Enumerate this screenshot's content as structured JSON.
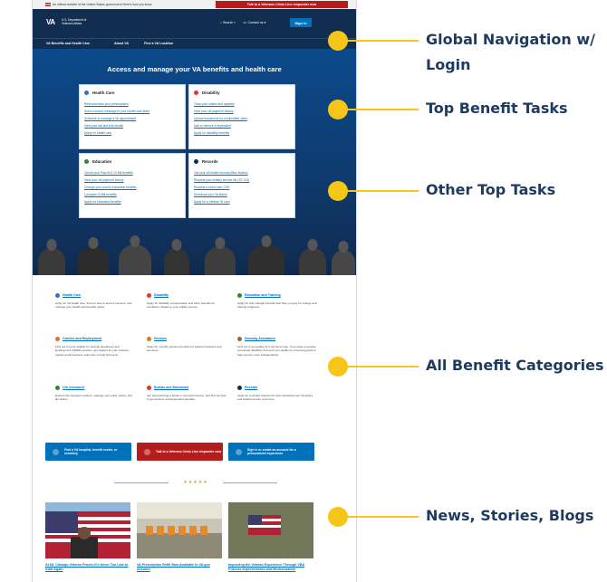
{
  "govbar": {
    "text": "An official website of the United States government  Here's how you know",
    "crisis_label": "Talk to a Veterans Crisis Line responder now"
  },
  "header": {
    "logo": "VA",
    "org_name": "U.S. Department of Veterans Affairs",
    "search_label": "Search",
    "contact_label": "Contact us",
    "signin_label": "Sign in"
  },
  "nav": {
    "items": [
      "VA Benefits and Health Care",
      "About VA",
      "Find a VA Location"
    ]
  },
  "hero": {
    "title": "Access and manage your VA benefits and health care",
    "cards": [
      {
        "title": "Health Care",
        "icon": "health-care-icon",
        "color": "#2378c3",
        "links": [
          "Refill and track your prescriptions",
          "Send a secure message to your health care team",
          "Schedule or manage a VA appointment",
          "View your lab and test results",
          "Apply for health care"
        ]
      },
      {
        "title": "Disability",
        "icon": "disability-icon",
        "color": "#d83933",
        "links": [
          "Track your claims and appeals",
          "View your VA payment history",
          "Upload documents for a submitted claim",
          "Add or remove a dependent",
          "Apply for disability benefits"
        ]
      },
      {
        "title": "Education",
        "icon": "education-icon",
        "color": "#2e8540",
        "links": [
          "Check your Post-9/11 GI Bill benefits",
          "View your VA payment history",
          "Change your current education benefits",
          "Compare GI Bill benefits",
          "Apply for education benefits"
        ]
      },
      {
        "title": "Records",
        "icon": "records-icon",
        "color": "#112e51",
        "links": [
          "Get your VA health records (Blue Button)",
          "Request your military service file (SF-214)",
          "Request a home loan COE",
          "Download your VA letters",
          "Apply for a Veteran ID card"
        ]
      }
    ]
  },
  "benefits": [
    {
      "title": "Health Care",
      "color": "#2378c3",
      "desc": "Apply for VA health care, find out how to access services, and manage your health and benefits online."
    },
    {
      "title": "Disability",
      "color": "#d83933",
      "desc": "Apply for disability compensation and other benefits for conditions related to your military service."
    },
    {
      "title": "Education and Training",
      "color": "#2e8540",
      "desc": "Apply for and manage benefits that help you pay for college and training programs."
    },
    {
      "title": "Careers and Employment",
      "color": "#e5751f",
      "desc": "Find out if you're eligible for Veteran Readiness and Employment (VR&E) services, get support for your Veteran-owned small business, and more to help find a job."
    },
    {
      "title": "Pension",
      "color": "#e5751f",
      "desc": "Apply for monthly pension benefits for wartime Veterans and survivors."
    },
    {
      "title": "Housing Assistance",
      "color": "#8b6e3f",
      "desc": "Find out if you qualify for a VA home loan. If you have a service-connected disability, find out if you qualify for a housing grant to help you live more independently."
    },
    {
      "title": "Life Insurance",
      "color": "#2e8540",
      "desc": "Explore life insurance options, manage your policy online, and file claims."
    },
    {
      "title": "Burials and Memorials",
      "color": "#d83933",
      "desc": "Get help planning a burial or memorial service, and find out how to get survivor and dependent benefits."
    },
    {
      "title": "Records",
      "color": "#112e51",
      "desc": "Apply for a printed Veteran ID card, download your VA letters and health records, and more."
    }
  ],
  "ctas": [
    {
      "label": "Find a VA hospital, benefit center, or cemetery",
      "color": "#0071bb"
    },
    {
      "label": "Talk to a Veterans Crisis Line responder now",
      "color": "#b51d1d"
    },
    {
      "label": "Sign in or create an account for a personalized experience",
      "color": "#0071bb"
    }
  ],
  "stars": "★★★★★",
  "news": [
    {
      "title": "At 68, Chicago Veteran Proves It's Never Too Late to Start Again"
    },
    {
      "title": "VA Prescription Refill Now Available in VA.gov Account"
    },
    {
      "title": "Improving the Veteran Experience Through VBA Process Improvements and Modernization"
    }
  ],
  "callouts": [
    "Global Navigation w/ Login",
    "Top Benefit Tasks",
    "Other Top Tasks",
    "All Benefit Categories",
    "News, Stories, Blogs"
  ]
}
